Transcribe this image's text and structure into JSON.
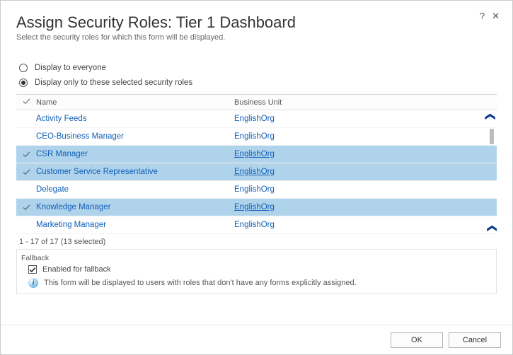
{
  "header": {
    "title": "Assign Security Roles: Tier 1 Dashboard",
    "subtitle": "Select the security roles for which this form will be displayed.",
    "help": "?",
    "close": "✕"
  },
  "options": {
    "everyone": "Display to everyone",
    "selected": "Display only to these selected security roles",
    "choice": "selected"
  },
  "grid": {
    "columns": {
      "name": "Name",
      "bu": "Business Unit"
    },
    "rows": [
      {
        "name": "Activity Feeds",
        "bu": "EnglishOrg",
        "selected": false
      },
      {
        "name": "CEO-Business Manager",
        "bu": "EnglishOrg",
        "selected": false
      },
      {
        "name": "CSR Manager",
        "bu": "EnglishOrg",
        "selected": true
      },
      {
        "name": "Customer Service Representative",
        "bu": "EnglishOrg",
        "selected": true
      },
      {
        "name": "Delegate",
        "bu": "EnglishOrg",
        "selected": false
      },
      {
        "name": "Knowledge Manager",
        "bu": "EnglishOrg",
        "selected": true
      },
      {
        "name": "Marketing Manager",
        "bu": "EnglishOrg",
        "selected": false
      }
    ],
    "pager": "1 - 17 of 17 (13 selected)"
  },
  "fallback": {
    "section": "Fallback",
    "enabled_label": "Enabled for fallback",
    "enabled": true,
    "help": "This form will be displayed to users with roles that don't have any forms explicitly assigned."
  },
  "buttons": {
    "ok": "OK",
    "cancel": "Cancel"
  }
}
